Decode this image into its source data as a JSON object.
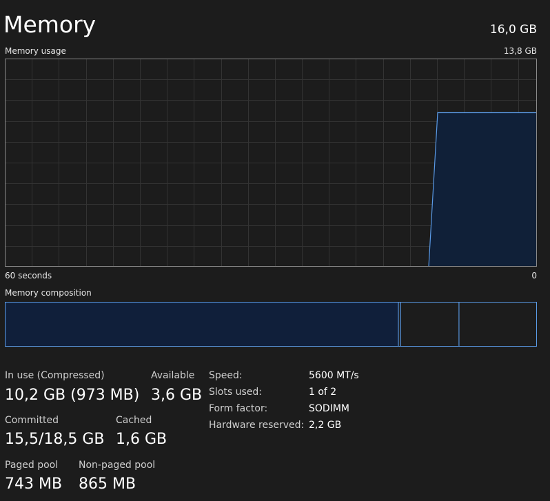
{
  "header": {
    "title": "Memory",
    "total": "16,0 GB"
  },
  "usage_graph": {
    "label": "Memory usage",
    "max_label": "13,8 GB",
    "time_label": "60 seconds",
    "end_label": "0",
    "current_fraction": 0.74,
    "colors": {
      "line": "#5a9ae6",
      "fill": "#102038",
      "grid": "#333333",
      "border": "#8a8a8a"
    }
  },
  "composition": {
    "label": "Memory composition",
    "segments_fraction": {
      "in_use": 0.74,
      "modified": 0.004,
      "standby": 0.11,
      "free": 0.146
    },
    "colors": {
      "in_use_fill": "#101f3a",
      "border": "#5a9ae6"
    }
  },
  "stats": {
    "in_use_label": "In use (Compressed)",
    "in_use_value": "10,2 GB (973 MB)",
    "available_label": "Available",
    "available_value": "3,6 GB",
    "committed_label": "Committed",
    "committed_value": "15,5/18,5 GB",
    "cached_label": "Cached",
    "cached_value": "1,6 GB",
    "paged_pool_label": "Paged pool",
    "paged_pool_value": "743 MB",
    "nonpaged_pool_label": "Non-paged pool",
    "nonpaged_pool_value": "865 MB"
  },
  "specs": [
    {
      "label": "Speed:",
      "value": "5600 MT/s"
    },
    {
      "label": "Slots used:",
      "value": "1 of 2"
    },
    {
      "label": "Form factor:",
      "value": "SODIMM"
    },
    {
      "label": "Hardware reserved:",
      "value": "2,2 GB"
    }
  ]
}
